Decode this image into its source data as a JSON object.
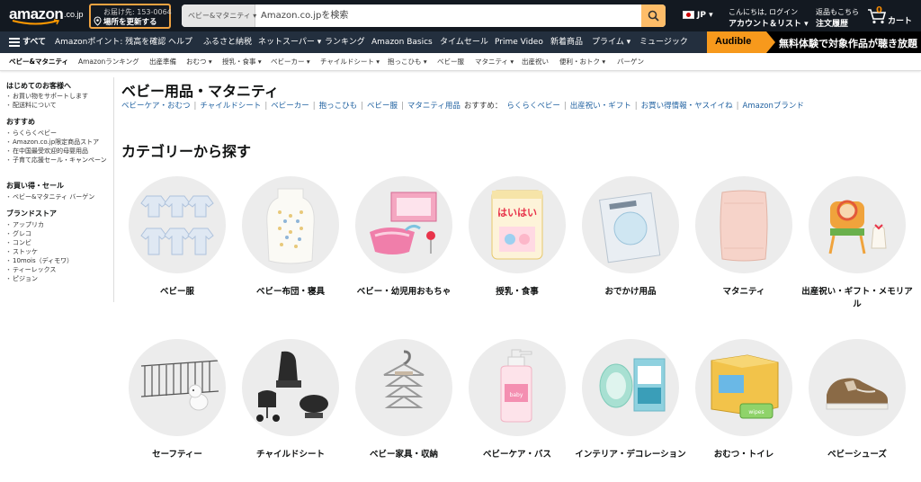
{
  "header": {
    "logo_text": "amazon",
    "logo_tld": ".co.jp",
    "deliver_line1": "お届け先: 153-0064",
    "deliver_line2": "場所を更新する",
    "search_category": "ベビー&マタニティ ▾",
    "search_placeholder": "Amazon.co.jpを検索",
    "lang": "JP ▾",
    "account_line1": "こんにちは, ログイン",
    "account_line2": "アカウント＆リスト ▾",
    "orders_line1": "返品もこちら",
    "orders_line2": "注文履歴",
    "cart_count": "0",
    "cart_label": "カート"
  },
  "nav": {
    "all_label": "すべて",
    "items": [
      "Amazonポイント: 残高を確認",
      "ヘルプ",
      "ふるさと納税",
      "ネットスーパー ▾",
      "ランキング",
      "Amazon Basics",
      "タイムセール",
      "Prime Video",
      "新着商品",
      "プライム ▾",
      "ミュージック"
    ],
    "promo_badge": "Audible",
    "promo_text": "無料体験で対象作品が聴き放題"
  },
  "subnav": {
    "items": [
      "ベビー&マタニティ",
      "Amazonランキング",
      "出産準備",
      "おむつ ▾",
      "授乳・食事 ▾",
      "ベビーカー ▾",
      "チャイルドシート ▾",
      "抱っこひも ▾",
      "ベビー服",
      "マタニティ ▾",
      "出産祝い",
      "便利・おトク ▾",
      "バーゲン"
    ]
  },
  "sidebar": {
    "sections": [
      {
        "heading": "はじめてのお客様へ",
        "items": [
          "お買い物をサポートします",
          "配送料について"
        ]
      },
      {
        "heading": "おすすめ",
        "items": [
          "らくらくベビー",
          "Amazon.co.jp限定商品ストア",
          "在中国最受欢迎的母婴用品",
          "子育て応援セール・キャンペーン"
        ]
      },
      {
        "heading": "お買い得・セール",
        "items": [
          "ベビー&マタニティ バーゲン"
        ]
      },
      {
        "heading": "ブランドストア",
        "items": [
          "アップリカ",
          "グレコ",
          "コンビ",
          "ストッケ",
          "10mois（ディモワ）",
          "ティーレックス",
          "ピジョン"
        ]
      }
    ]
  },
  "main": {
    "title": "ベビー用品・マタニティ",
    "links": [
      "ベビーケア・おむつ",
      "チャイルドシート",
      "ベビーカー",
      "抱っこひも",
      "ベビー服",
      "マタニティ用品"
    ],
    "recommend_label": "おすすめ：",
    "recommend_links": [
      "らくらくベビー",
      "出産祝い・ギフト",
      "お買い得情報・ヤスイイね",
      "Amazonブランド"
    ],
    "section_title": "カテゴリーから探す",
    "categories": [
      {
        "label": "ベビー服",
        "icon": "baby-clothes-icon"
      },
      {
        "label": "ベビー布団・寝具",
        "icon": "sleeping-bag-icon"
      },
      {
        "label": "ベビー・幼児用おもちゃ",
        "icon": "toy-icon"
      },
      {
        "label": "授乳・食事",
        "icon": "formula-can-icon"
      },
      {
        "label": "おでかけ用品",
        "icon": "outing-pack-icon"
      },
      {
        "label": "マタニティ",
        "icon": "maternity-belt-icon"
      },
      {
        "label": "出産祝い・ギフト・メモリアル",
        "icon": "gift-chair-icon"
      },
      {
        "label": "セーフティー",
        "icon": "safety-gate-icon"
      },
      {
        "label": "チャイルドシート",
        "icon": "car-seat-icon"
      },
      {
        "label": "ベビー家具・収納",
        "icon": "hangers-icon"
      },
      {
        "label": "ベビーケア・バス",
        "icon": "soap-bottle-icon"
      },
      {
        "label": "インテリア・デコレーション",
        "icon": "decoration-icon"
      },
      {
        "label": "おむつ・トイレ",
        "icon": "diaper-box-icon"
      },
      {
        "label": "ベビーシューズ",
        "icon": "baby-shoe-icon"
      }
    ]
  },
  "colors": {
    "header_bg": "#131921",
    "nav_bg": "#232f3e",
    "accent": "#febd69",
    "link": "#2162a1",
    "audible": "#f7991c"
  }
}
